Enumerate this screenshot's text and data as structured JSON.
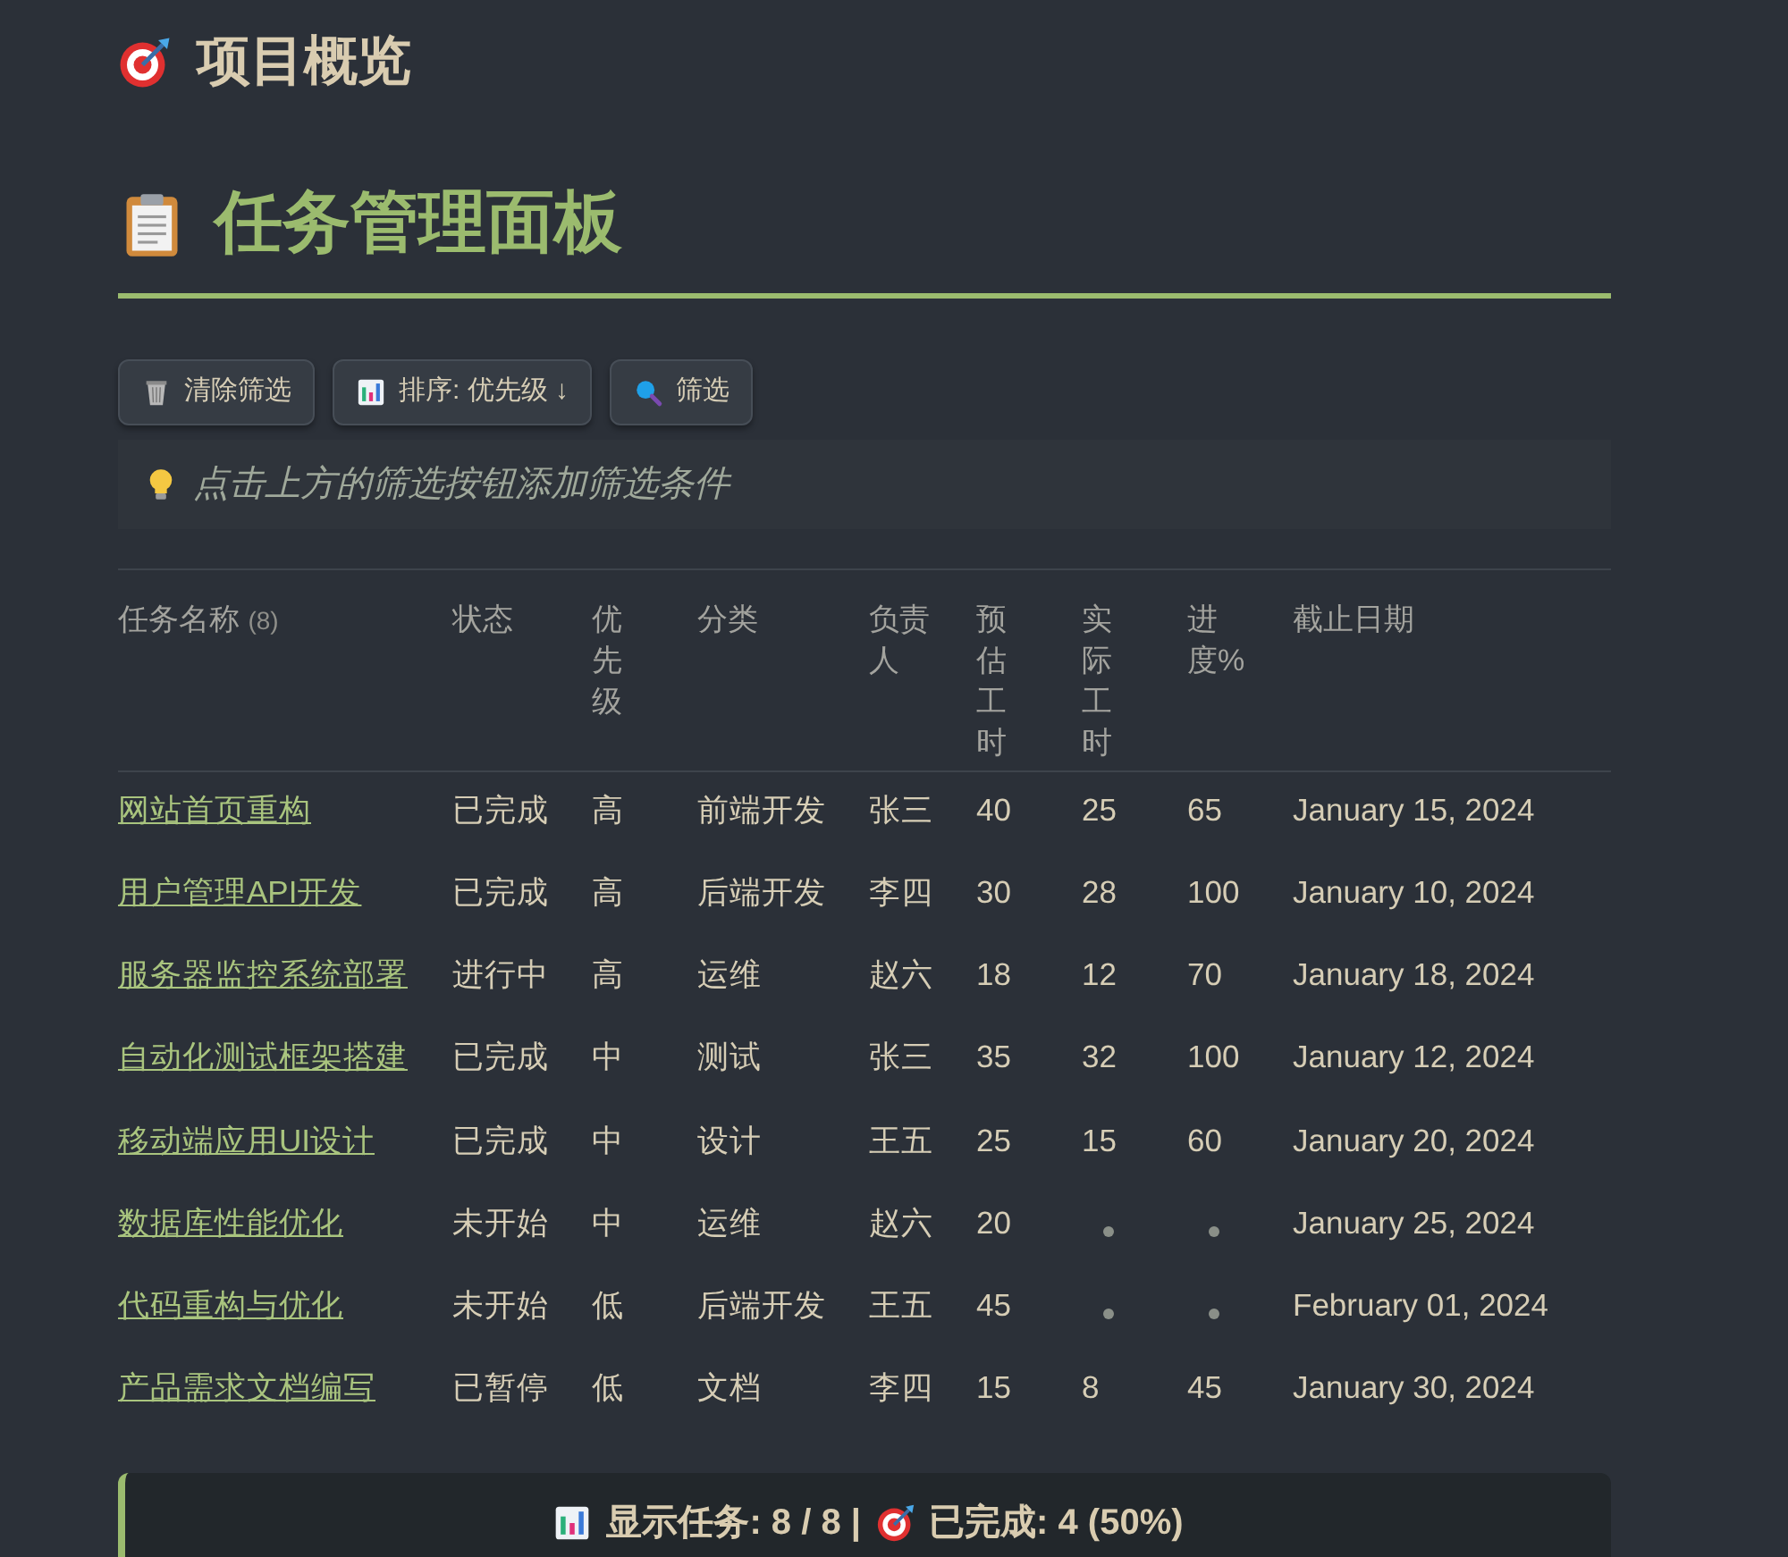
{
  "overview_title": "项目概览",
  "board_title": "任务管理面板",
  "toolbar": [
    {
      "kind": "clear",
      "label": "清除筛选"
    },
    {
      "kind": "sort",
      "label": "排序: 优先级 ↓"
    },
    {
      "kind": "filter",
      "label": "筛选"
    }
  ],
  "hint": "点击上方的筛选按钮添加筛选条件",
  "table": {
    "columns": [
      {
        "label": "任务名称",
        "count": "(8)"
      },
      {
        "label": "状态"
      },
      {
        "label": "优先级"
      },
      {
        "label": "分类"
      },
      {
        "label": "负责人"
      },
      {
        "label": "预估工时"
      },
      {
        "label": "实际工时"
      },
      {
        "label": "进度%"
      },
      {
        "label": "截止日期"
      }
    ],
    "rows": [
      [
        "网站首页重构",
        "已完成",
        "高",
        "前端开发",
        "张三",
        "40",
        "25",
        "65",
        "January 15, 2024"
      ],
      [
        "用户管理API开发",
        "已完成",
        "高",
        "后端开发",
        "李四",
        "30",
        "28",
        "100",
        "January 10, 2024"
      ],
      [
        "服务器监控系统部署",
        "进行中",
        "高",
        "运维",
        "赵六",
        "18",
        "12",
        "70",
        "January 18, 2024"
      ],
      [
        "自动化测试框架搭建",
        "已完成",
        "中",
        "测试",
        "张三",
        "35",
        "32",
        "100",
        "January 12, 2024"
      ],
      [
        "移动端应用UI设计",
        "已完成",
        "中",
        "设计",
        "王五",
        "25",
        "15",
        "60",
        "January 20, 2024"
      ],
      [
        "数据库性能优化",
        "未开始",
        "中",
        "运维",
        "赵六",
        "20",
        null,
        null,
        "January 25, 2024"
      ],
      [
        "代码重构与优化",
        "未开始",
        "低",
        "后端开发",
        "王五",
        "45",
        null,
        null,
        "February 01, 2024"
      ],
      [
        "产品需求文档编写",
        "已暂停",
        "低",
        "文档",
        "李四",
        "15",
        "8",
        "45",
        "January 30, 2024"
      ]
    ]
  },
  "summary": {
    "shown_label": "显示任务: 8 / 8 |",
    "done_label": "已完成: 4 (50%)"
  }
}
